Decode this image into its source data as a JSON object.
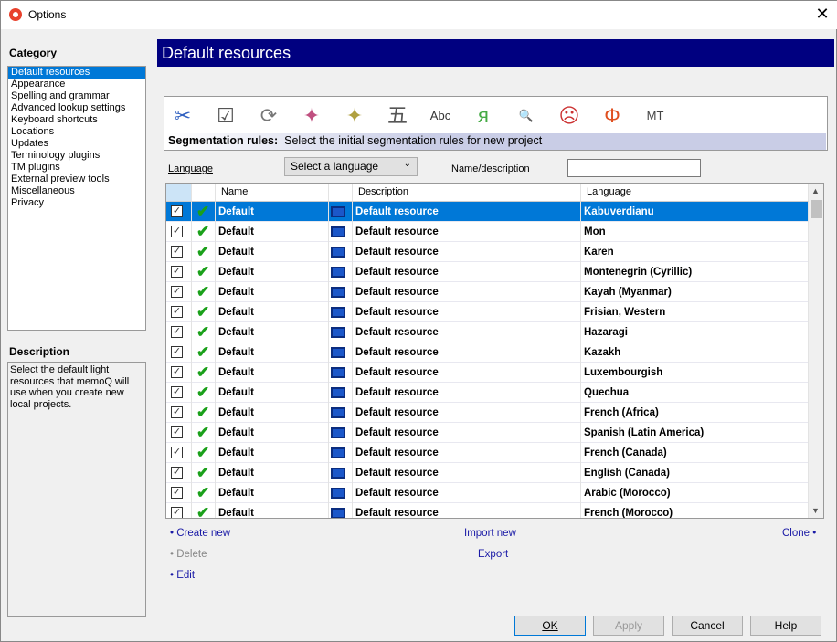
{
  "window": {
    "title": "Options",
    "close": "✕"
  },
  "category": {
    "label": "Category",
    "items": [
      "Default resources",
      "Appearance",
      "Spelling and grammar",
      "Advanced lookup settings",
      "Keyboard shortcuts",
      "Locations",
      "Updates",
      "Terminology plugins",
      "TM plugins",
      "External preview tools",
      "Miscellaneous",
      "Privacy"
    ],
    "selected": 0
  },
  "description": {
    "label": "Description",
    "text": "Select the default light resources that memoQ will use when you create new local projects."
  },
  "header": {
    "title": "Default resources"
  },
  "toolbar": {
    "icons": [
      "segmentation-rules-icon",
      "qa-settings-icon",
      "autotranslation-rules-icon",
      "filter-config-icon",
      "export-path-rules-icon",
      "auto-translatables-icon",
      "ignore-list-icon",
      "non-translatables-icon",
      "lqa-web-search-icon",
      "keyboard-shortcuts-icon",
      "font-substitution-icon",
      "mt-settings-icon"
    ],
    "glyphs": [
      "✂",
      "☑",
      "⟳",
      "✦",
      "✦",
      "五",
      "Abc",
      "я",
      "🔍",
      "☹",
      "Φ",
      "MT"
    ],
    "section": "Segmentation rules:",
    "section_desc": "Select the initial segmentation rules for new project"
  },
  "filter": {
    "language_label": "Language",
    "language_value": "Select a language",
    "name_label": "Name/description",
    "name_value": ""
  },
  "grid": {
    "columns": [
      "Name",
      "Description",
      "Language"
    ],
    "rows": [
      {
        "name": "Default",
        "description": "Default resource",
        "language": "Kabuverdianu"
      },
      {
        "name": "Default",
        "description": "Default resource",
        "language": "Mon"
      },
      {
        "name": "Default",
        "description": "Default resource",
        "language": "Karen"
      },
      {
        "name": "Default",
        "description": "Default resource",
        "language": "Montenegrin (Cyrillic)"
      },
      {
        "name": "Default",
        "description": "Default resource",
        "language": "Kayah (Myanmar)"
      },
      {
        "name": "Default",
        "description": "Default resource",
        "language": "Frisian, Western"
      },
      {
        "name": "Default",
        "description": "Default resource",
        "language": "Hazaragi"
      },
      {
        "name": "Default",
        "description": "Default resource",
        "language": "Kazakh"
      },
      {
        "name": "Default",
        "description": "Default resource",
        "language": "Luxembourgish"
      },
      {
        "name": "Default",
        "description": "Default resource",
        "language": "Quechua"
      },
      {
        "name": "Default",
        "description": "Default resource",
        "language": "French (Africa)"
      },
      {
        "name": "Default",
        "description": "Default resource",
        "language": "Spanish (Latin America)"
      },
      {
        "name": "Default",
        "description": "Default resource",
        "language": "French (Canada)"
      },
      {
        "name": "Default",
        "description": "Default resource",
        "language": "English (Canada)"
      },
      {
        "name": "Default",
        "description": "Default resource",
        "language": "Arabic (Morocco)"
      },
      {
        "name": "Default",
        "description": "Default resource",
        "language": "French (Morocco)"
      }
    ],
    "selected": 0
  },
  "actions": {
    "create_new": "• Create new",
    "delete": "• Delete",
    "edit": "• Edit",
    "import_new": "Import new",
    "export": "Export",
    "clone": "Clone •"
  },
  "buttons": {
    "ok": "OK",
    "apply": "Apply",
    "cancel": "Cancel",
    "help": "Help"
  },
  "colors": {
    "header_bg": "#000080",
    "selection": "#0078d7",
    "link": "#1a1aa6"
  }
}
